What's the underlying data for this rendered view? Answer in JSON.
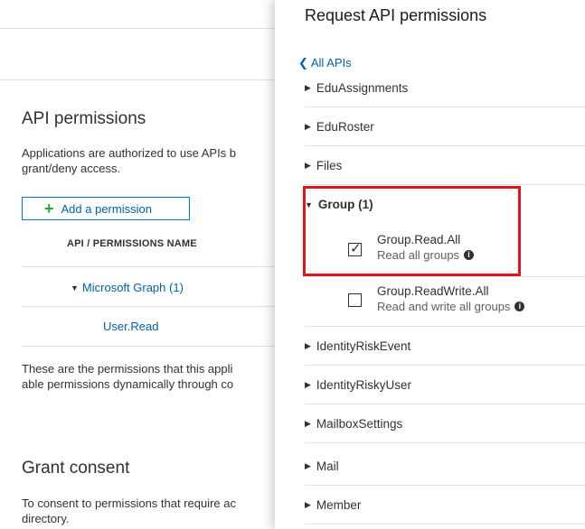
{
  "left": {
    "section_title": "API permissions",
    "desc_line1": "Applications are authorized to use APIs b",
    "desc_line2": "grant/deny access.",
    "add_permission": "Add a permission",
    "col_header": "API / PERMISSIONS NAME",
    "api_name": "Microsoft Graph (1)",
    "permission": "User.Read",
    "perm_note_line1": "These are the permissions that this appli",
    "perm_note_line2": "able permissions dynamically through co",
    "consent_title": "Grant consent",
    "consent_line1": "To consent to permissions that require ac",
    "consent_line2": "directory."
  },
  "panel": {
    "title": "Request API permissions",
    "back_link": "All APIs",
    "items": [
      {
        "label": "EduAssignments"
      },
      {
        "label": "EduRoster"
      },
      {
        "label": "Files"
      },
      {
        "label": "Group (1)"
      },
      {
        "label": "IdentityRiskEvent"
      },
      {
        "label": "IdentityRiskyUser"
      },
      {
        "label": "MailboxSettings"
      },
      {
        "label": "Mail"
      },
      {
        "label": "Member"
      }
    ],
    "group_permissions": [
      {
        "name": "Group.Read.All",
        "description": "Read all groups",
        "checked": true
      },
      {
        "name": "Group.ReadWrite.All",
        "description": "Read and write all groups",
        "checked": false
      }
    ]
  },
  "colors": {
    "link": "#0062ad",
    "accent_border": "#0078d4",
    "highlight": "#e3141e",
    "plus": "#2fa62f"
  }
}
